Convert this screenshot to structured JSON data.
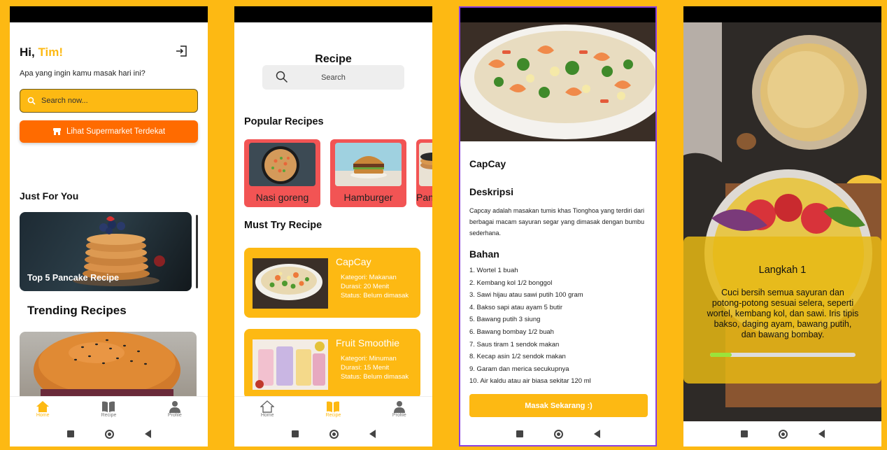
{
  "home": {
    "greeting_prefix": "Hi, ",
    "greeting_name": "Tim!",
    "subtitle": "Apa yang ingin kamu masak hari ini?",
    "search_placeholder": "Search now...",
    "supermarket_button": "Lihat Supermarket Terdekat",
    "just_for_you": "Just For You",
    "featured_card": "Top 5 Pancake Recipe",
    "trending": "Trending Recipes"
  },
  "nav": [
    {
      "label": "Home",
      "icon": "home-icon"
    },
    {
      "label": "Recipe",
      "icon": "book-icon"
    },
    {
      "label": "Profile",
      "icon": "person-icon"
    }
  ],
  "recipe_page": {
    "title": "Recipe",
    "search_placeholder": "Search",
    "popular_heading": "Popular Recipes",
    "popular": [
      "Nasi goreng",
      "Hamburger",
      "Pan"
    ],
    "must_try_heading": "Must Try Recipe",
    "must_try": [
      {
        "name": "CapCay",
        "kategori": "Kategori: Makanan",
        "durasi": "Durasi: 20 Menit",
        "status": "Status: Belum dimasak"
      },
      {
        "name": "Fruit Smoothie",
        "kategori": "Kategori: Minuman",
        "durasi": "Durasi: 15 Menit",
        "status": "Status: Belum dimasak"
      }
    ]
  },
  "detail": {
    "title": "CapCay",
    "desc_heading": "Deskripsi",
    "description": "Capcay adalah masakan tumis khas Tionghoa yang terdiri dari berbagai macam sayuran segar yang dimasak dengan bumbu sederhana.",
    "ingredients_heading": "Bahan",
    "ingredients": [
      "1. Wortel 1 buah",
      "2. Kembang kol 1/2 bonggol",
      "3. Sawi hijau atau sawi putih 100 gram",
      "4. Bakso sapi atau ayam 5 butir",
      "5. Bawang putih 3 siung",
      "6. Bawang bombay 1/2 buah",
      "7. Saus tiram 1 sendok makan",
      "8. Kecap asin 1/2 sendok makan",
      "9. Garam dan merica secukupnya",
      "10. Air kaldu atau air biasa sekitar 120 ml"
    ],
    "cook_button": "Masak Sekarang :)"
  },
  "step": {
    "title": "Langkah 1",
    "body": "Cuci bersih semua sayuran dan potong-potong sesuai selera, seperti wortel, kembang kol, dan sawi. Iris tipis bakso, daging ayam, bawang putih, dan bawang bombay.",
    "progress": 0.15
  },
  "colors": {
    "accent": "#FDB913",
    "orange": "#FF6B00",
    "red": "#F25454",
    "purple": "#8A3FE0"
  }
}
